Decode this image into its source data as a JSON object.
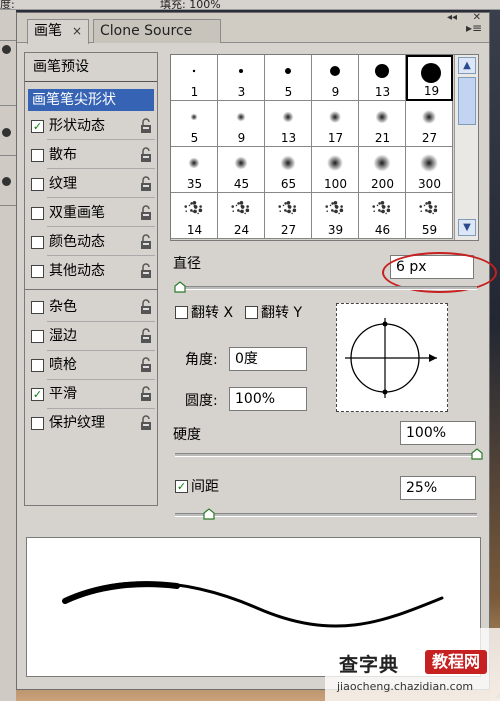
{
  "background": {
    "top_fragment_left": "度:",
    "top_fragment_right": "填充: 100%"
  },
  "tabs": [
    {
      "label": "画笔",
      "close": "×",
      "active": true
    },
    {
      "label": "Clone Source",
      "active": false
    }
  ],
  "panel_menu_icon": "panel-menu-icon",
  "left_list": {
    "preset": "画笔预设",
    "selected": "画笔笔尖形状",
    "options": [
      {
        "label": "形状动态",
        "checked": true
      },
      {
        "label": "散布",
        "checked": false
      },
      {
        "label": "纹理",
        "checked": false
      },
      {
        "label": "双重画笔",
        "checked": false
      },
      {
        "label": "颜色动态",
        "checked": false
      },
      {
        "label": "其他动态",
        "checked": false
      },
      {
        "label": "杂色",
        "checked": false
      },
      {
        "label": "湿边",
        "checked": false
      },
      {
        "label": "喷枪",
        "checked": false
      },
      {
        "label": "平滑",
        "checked": true
      },
      {
        "label": "保护纹理",
        "checked": false
      }
    ]
  },
  "brushes": [
    {
      "size": "1",
      "type": "hard"
    },
    {
      "size": "3",
      "type": "hard"
    },
    {
      "size": "5",
      "type": "hard"
    },
    {
      "size": "9",
      "type": "hard"
    },
    {
      "size": "13",
      "type": "hard"
    },
    {
      "size": "19",
      "type": "hard",
      "selected": true
    },
    {
      "size": "5",
      "type": "soft"
    },
    {
      "size": "9",
      "type": "soft"
    },
    {
      "size": "13",
      "type": "soft"
    },
    {
      "size": "17",
      "type": "soft"
    },
    {
      "size": "21",
      "type": "soft"
    },
    {
      "size": "27",
      "type": "soft"
    },
    {
      "size": "35",
      "type": "soft"
    },
    {
      "size": "45",
      "type": "soft"
    },
    {
      "size": "65",
      "type": "soft"
    },
    {
      "size": "100",
      "type": "soft"
    },
    {
      "size": "200",
      "type": "soft"
    },
    {
      "size": "300",
      "type": "soft"
    },
    {
      "size": "14",
      "type": "splatter"
    },
    {
      "size": "24",
      "type": "splatter"
    },
    {
      "size": "27",
      "type": "splatter"
    },
    {
      "size": "39",
      "type": "splatter"
    },
    {
      "size": "46",
      "type": "splatter"
    },
    {
      "size": "59",
      "type": "splatter"
    }
  ],
  "props": {
    "diameter_label": "直径",
    "diameter_value": "6 px",
    "flip_x": "翻转 X",
    "flip_y": "翻转 Y",
    "angle_label": "角度:",
    "angle_value": "0度",
    "roundness_label": "圆度:",
    "roundness_value": "100%",
    "hardness_label": "硬度",
    "hardness_value": "100%",
    "spacing_label": "间距",
    "spacing_value": "25%",
    "spacing_checked": true
  },
  "watermark": {
    "title": "查字典",
    "badge": "教程网",
    "url": "jiaocheng.chazidian.com"
  },
  "colors": {
    "selection": "#3763b5",
    "annotation_oval": "#c62020"
  }
}
